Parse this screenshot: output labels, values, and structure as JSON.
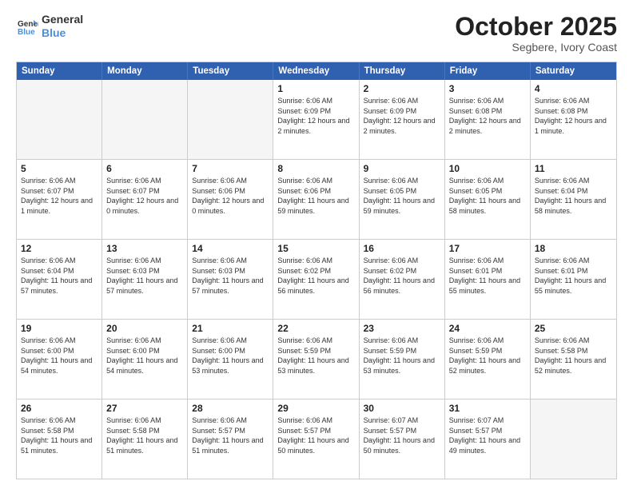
{
  "logo": {
    "line1": "General",
    "line2": "Blue"
  },
  "header": {
    "month": "October 2025",
    "location": "Segbere, Ivory Coast"
  },
  "weekdays": [
    "Sunday",
    "Monday",
    "Tuesday",
    "Wednesday",
    "Thursday",
    "Friday",
    "Saturday"
  ],
  "weeks": [
    [
      {
        "day": "",
        "info": ""
      },
      {
        "day": "",
        "info": ""
      },
      {
        "day": "",
        "info": ""
      },
      {
        "day": "1",
        "info": "Sunrise: 6:06 AM\nSunset: 6:09 PM\nDaylight: 12 hours and 2 minutes."
      },
      {
        "day": "2",
        "info": "Sunrise: 6:06 AM\nSunset: 6:09 PM\nDaylight: 12 hours and 2 minutes."
      },
      {
        "day": "3",
        "info": "Sunrise: 6:06 AM\nSunset: 6:08 PM\nDaylight: 12 hours and 2 minutes."
      },
      {
        "day": "4",
        "info": "Sunrise: 6:06 AM\nSunset: 6:08 PM\nDaylight: 12 hours and 1 minute."
      }
    ],
    [
      {
        "day": "5",
        "info": "Sunrise: 6:06 AM\nSunset: 6:07 PM\nDaylight: 12 hours and 1 minute."
      },
      {
        "day": "6",
        "info": "Sunrise: 6:06 AM\nSunset: 6:07 PM\nDaylight: 12 hours and 0 minutes."
      },
      {
        "day": "7",
        "info": "Sunrise: 6:06 AM\nSunset: 6:06 PM\nDaylight: 12 hours and 0 minutes."
      },
      {
        "day": "8",
        "info": "Sunrise: 6:06 AM\nSunset: 6:06 PM\nDaylight: 11 hours and 59 minutes."
      },
      {
        "day": "9",
        "info": "Sunrise: 6:06 AM\nSunset: 6:05 PM\nDaylight: 11 hours and 59 minutes."
      },
      {
        "day": "10",
        "info": "Sunrise: 6:06 AM\nSunset: 6:05 PM\nDaylight: 11 hours and 58 minutes."
      },
      {
        "day": "11",
        "info": "Sunrise: 6:06 AM\nSunset: 6:04 PM\nDaylight: 11 hours and 58 minutes."
      }
    ],
    [
      {
        "day": "12",
        "info": "Sunrise: 6:06 AM\nSunset: 6:04 PM\nDaylight: 11 hours and 57 minutes."
      },
      {
        "day": "13",
        "info": "Sunrise: 6:06 AM\nSunset: 6:03 PM\nDaylight: 11 hours and 57 minutes."
      },
      {
        "day": "14",
        "info": "Sunrise: 6:06 AM\nSunset: 6:03 PM\nDaylight: 11 hours and 57 minutes."
      },
      {
        "day": "15",
        "info": "Sunrise: 6:06 AM\nSunset: 6:02 PM\nDaylight: 11 hours and 56 minutes."
      },
      {
        "day": "16",
        "info": "Sunrise: 6:06 AM\nSunset: 6:02 PM\nDaylight: 11 hours and 56 minutes."
      },
      {
        "day": "17",
        "info": "Sunrise: 6:06 AM\nSunset: 6:01 PM\nDaylight: 11 hours and 55 minutes."
      },
      {
        "day": "18",
        "info": "Sunrise: 6:06 AM\nSunset: 6:01 PM\nDaylight: 11 hours and 55 minutes."
      }
    ],
    [
      {
        "day": "19",
        "info": "Sunrise: 6:06 AM\nSunset: 6:00 PM\nDaylight: 11 hours and 54 minutes."
      },
      {
        "day": "20",
        "info": "Sunrise: 6:06 AM\nSunset: 6:00 PM\nDaylight: 11 hours and 54 minutes."
      },
      {
        "day": "21",
        "info": "Sunrise: 6:06 AM\nSunset: 6:00 PM\nDaylight: 11 hours and 53 minutes."
      },
      {
        "day": "22",
        "info": "Sunrise: 6:06 AM\nSunset: 5:59 PM\nDaylight: 11 hours and 53 minutes."
      },
      {
        "day": "23",
        "info": "Sunrise: 6:06 AM\nSunset: 5:59 PM\nDaylight: 11 hours and 53 minutes."
      },
      {
        "day": "24",
        "info": "Sunrise: 6:06 AM\nSunset: 5:59 PM\nDaylight: 11 hours and 52 minutes."
      },
      {
        "day": "25",
        "info": "Sunrise: 6:06 AM\nSunset: 5:58 PM\nDaylight: 11 hours and 52 minutes."
      }
    ],
    [
      {
        "day": "26",
        "info": "Sunrise: 6:06 AM\nSunset: 5:58 PM\nDaylight: 11 hours and 51 minutes."
      },
      {
        "day": "27",
        "info": "Sunrise: 6:06 AM\nSunset: 5:58 PM\nDaylight: 11 hours and 51 minutes."
      },
      {
        "day": "28",
        "info": "Sunrise: 6:06 AM\nSunset: 5:57 PM\nDaylight: 11 hours and 51 minutes."
      },
      {
        "day": "29",
        "info": "Sunrise: 6:06 AM\nSunset: 5:57 PM\nDaylight: 11 hours and 50 minutes."
      },
      {
        "day": "30",
        "info": "Sunrise: 6:07 AM\nSunset: 5:57 PM\nDaylight: 11 hours and 50 minutes."
      },
      {
        "day": "31",
        "info": "Sunrise: 6:07 AM\nSunset: 5:57 PM\nDaylight: 11 hours and 49 minutes."
      },
      {
        "day": "",
        "info": ""
      }
    ]
  ]
}
